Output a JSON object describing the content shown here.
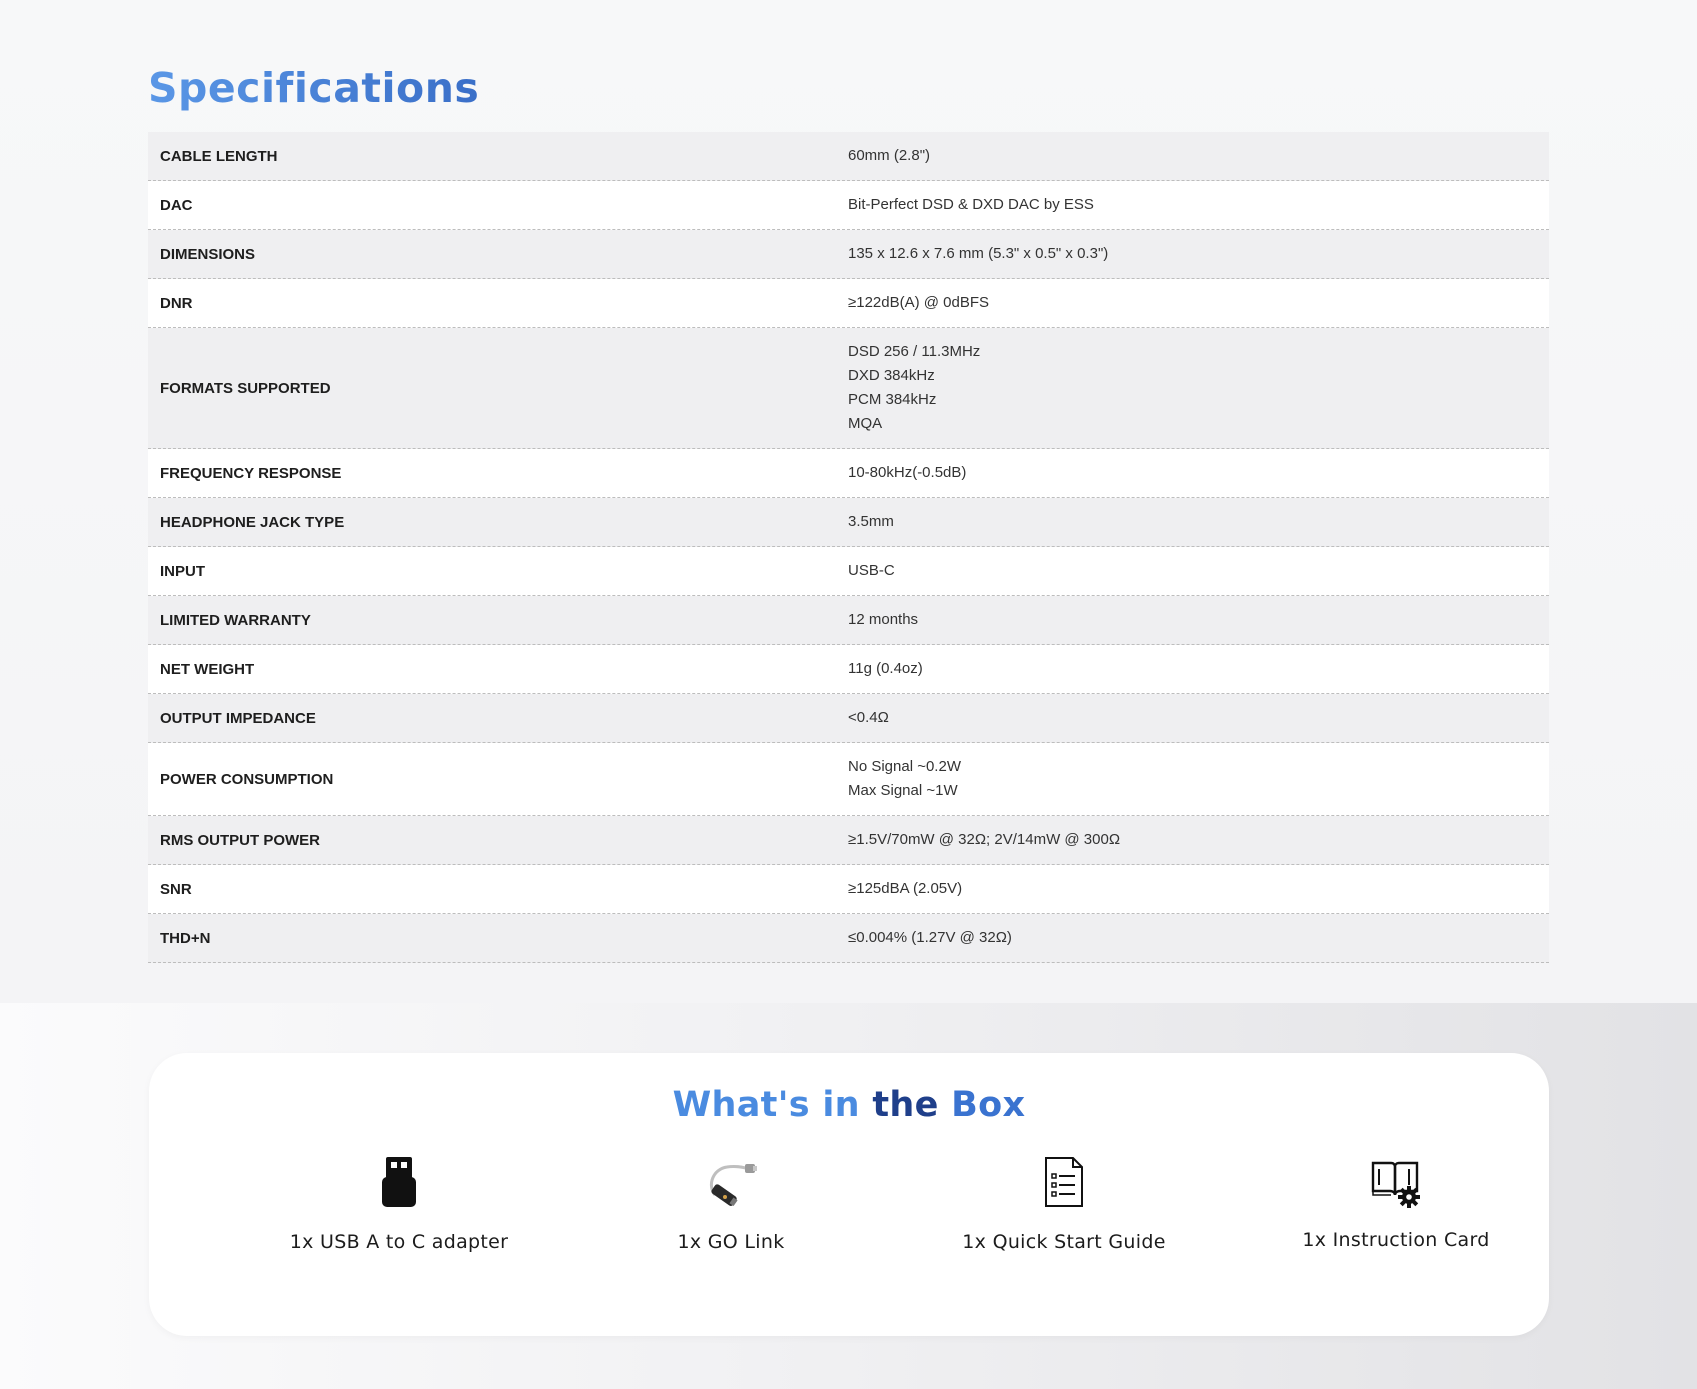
{
  "specifications": {
    "title": "Specifications",
    "rows": [
      {
        "key": "CABLE LENGTH",
        "values": [
          "60mm (2.8\")"
        ]
      },
      {
        "key": "DAC",
        "values": [
          "Bit-Perfect DSD & DXD DAC by ESS"
        ]
      },
      {
        "key": "DIMENSIONS",
        "values": [
          "135 x 12.6 x 7.6 mm (5.3\" x 0.5\" x 0.3\")"
        ]
      },
      {
        "key": "DNR",
        "values": [
          "≥122dB(A) @ 0dBFS"
        ]
      },
      {
        "key": "FORMATS SUPPORTED",
        "values": [
          "DSD 256 / 11.3MHz",
          "DXD 384kHz",
          "PCM 384kHz",
          "MQA"
        ]
      },
      {
        "key": "FREQUENCY RESPONSE",
        "values": [
          "10-80kHz(-0.5dB)"
        ]
      },
      {
        "key": "HEADPHONE JACK TYPE",
        "values": [
          "3.5mm"
        ]
      },
      {
        "key": "INPUT",
        "values": [
          "USB-C"
        ]
      },
      {
        "key": "LIMITED WARRANTY",
        "values": [
          "12 months"
        ]
      },
      {
        "key": "NET WEIGHT",
        "values": [
          "11g (0.4oz)"
        ]
      },
      {
        "key": "OUTPUT IMPEDANCE",
        "values": [
          "<0.4Ω"
        ]
      },
      {
        "key": "POWER CONSUMPTION",
        "values": [
          "No Signal ~0.2W",
          "Max Signal ~1W"
        ]
      },
      {
        "key": "RMS OUTPUT POWER",
        "values": [
          "≥1.5V/70mW @ 32Ω; 2V/14mW @ 300Ω"
        ]
      },
      {
        "key": "SNR",
        "values": [
          "≥125dBA (2.05V)"
        ]
      },
      {
        "key": "THD+N",
        "values": [
          "≤0.004% (1.27V @ 32Ω)"
        ]
      }
    ]
  },
  "whats_in_box": {
    "title_parts": [
      "What's in ",
      "the ",
      "Box"
    ],
    "items": [
      {
        "label": "1x USB A to C adapter",
        "icon": "usb-adapter-icon"
      },
      {
        "label": "1x GO Link",
        "icon": "go-link-cable-icon"
      },
      {
        "label": "1x Quick Start Guide",
        "icon": "document-list-icon"
      },
      {
        "label": "1x Instruction Card",
        "icon": "book-gear-icon"
      }
    ]
  },
  "colors": {
    "title_blue": "#4a86dc",
    "title_dark_blue": "#1f3f8a"
  }
}
